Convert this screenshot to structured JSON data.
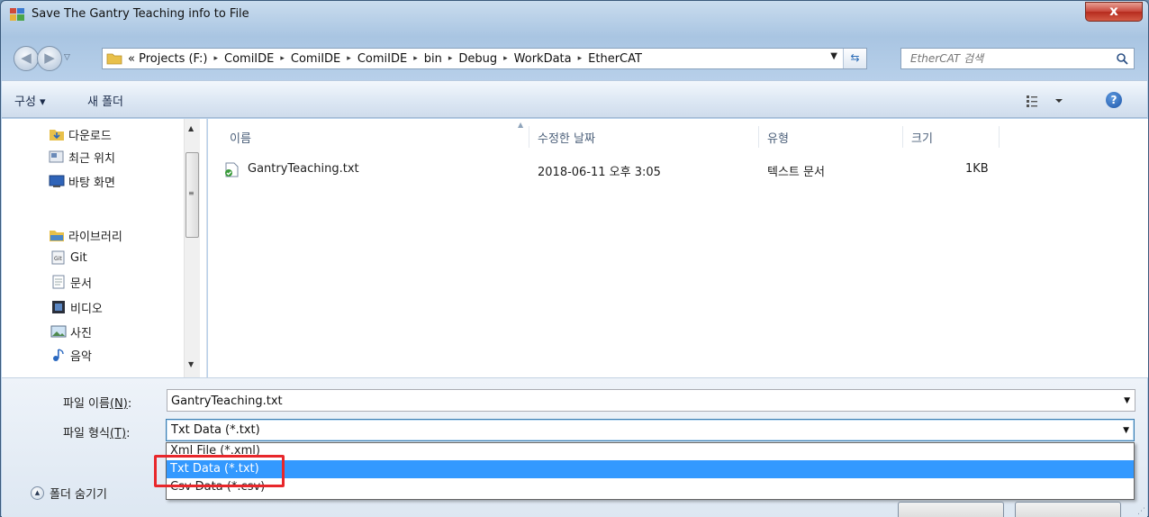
{
  "window": {
    "title": "Save The Gantry Teaching info to File",
    "close_label": "x"
  },
  "address": {
    "crumbs": [
      "« Projects (F:)",
      "ComiIDE",
      "ComiIDE",
      "ComiIDE",
      "bin",
      "Debug",
      "WorkData",
      "EtherCAT"
    ],
    "separator": "▸"
  },
  "search": {
    "placeholder": "EtherCAT 검색"
  },
  "toolbar": {
    "organize_label": "구성 ▾",
    "new_folder_label": "새 폴더",
    "help_label": "?"
  },
  "nav": {
    "items": [
      {
        "label": "다운로드",
        "icon": "download-folder-icon"
      },
      {
        "label": "최근 위치",
        "icon": "recent-places-icon"
      },
      {
        "label": "바탕 화면",
        "icon": "desktop-icon"
      }
    ],
    "library_label": "라이브러리",
    "library_items": [
      {
        "label": "Git",
        "icon": "git-library-icon"
      },
      {
        "label": "문서",
        "icon": "documents-icon"
      },
      {
        "label": "비디오",
        "icon": "video-icon"
      },
      {
        "label": "사진",
        "icon": "pictures-icon"
      },
      {
        "label": "음악",
        "icon": "music-icon"
      }
    ]
  },
  "columns": {
    "name": "이름",
    "modified": "수정한 날짜",
    "type": "유형",
    "size": "크기"
  },
  "files": [
    {
      "name": "GantryTeaching.txt",
      "modified": "2018-06-11 오후 3:05",
      "type": "텍스트 문서",
      "size": "1KB"
    }
  ],
  "form": {
    "filename_label": "파일 이름",
    "filename_key": "(N)",
    "filename_value": "GantryTeaching.txt",
    "filetype_label": "파일 형식",
    "filetype_key": "(T)",
    "filetype_value": "Txt Data (*.txt)",
    "filetype_options": [
      "Xml File (*.xml)",
      "Txt Data (*.txt)",
      "Csv Data (*.csv)"
    ],
    "selected_option_index": 1,
    "hide_folders_label": "폴더 숨기기"
  },
  "colors": {
    "highlight_box": "#e8272b",
    "selection": "#3399ff"
  }
}
